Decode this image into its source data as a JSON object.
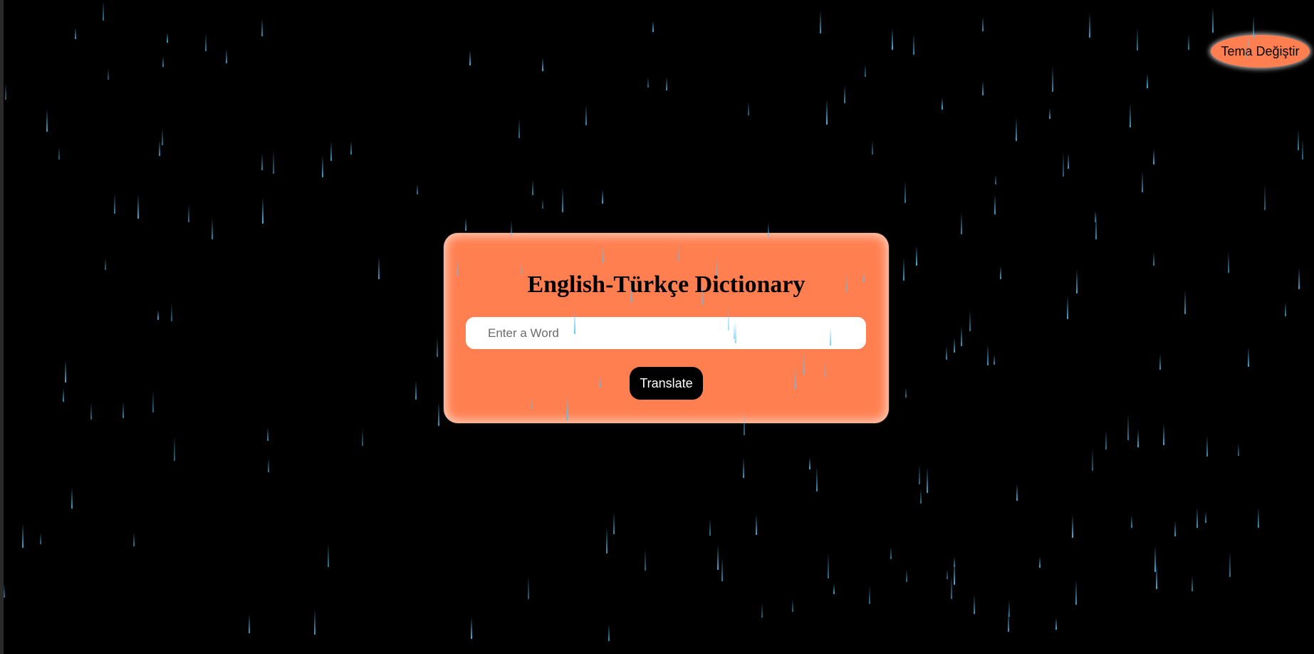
{
  "theme_toggle": {
    "label": "Tema Değiştir"
  },
  "dictionary": {
    "title": "English-Türkçe Dictionary",
    "input": {
      "placeholder": "Enter a Word",
      "value": ""
    },
    "translate_label": "Translate"
  },
  "colors": {
    "background": "#000000",
    "card": "#ff7f50",
    "rain": "#4fc3f7",
    "button": "#000000",
    "button_text": "#ffffff"
  },
  "icons": [
    "raindrop"
  ]
}
